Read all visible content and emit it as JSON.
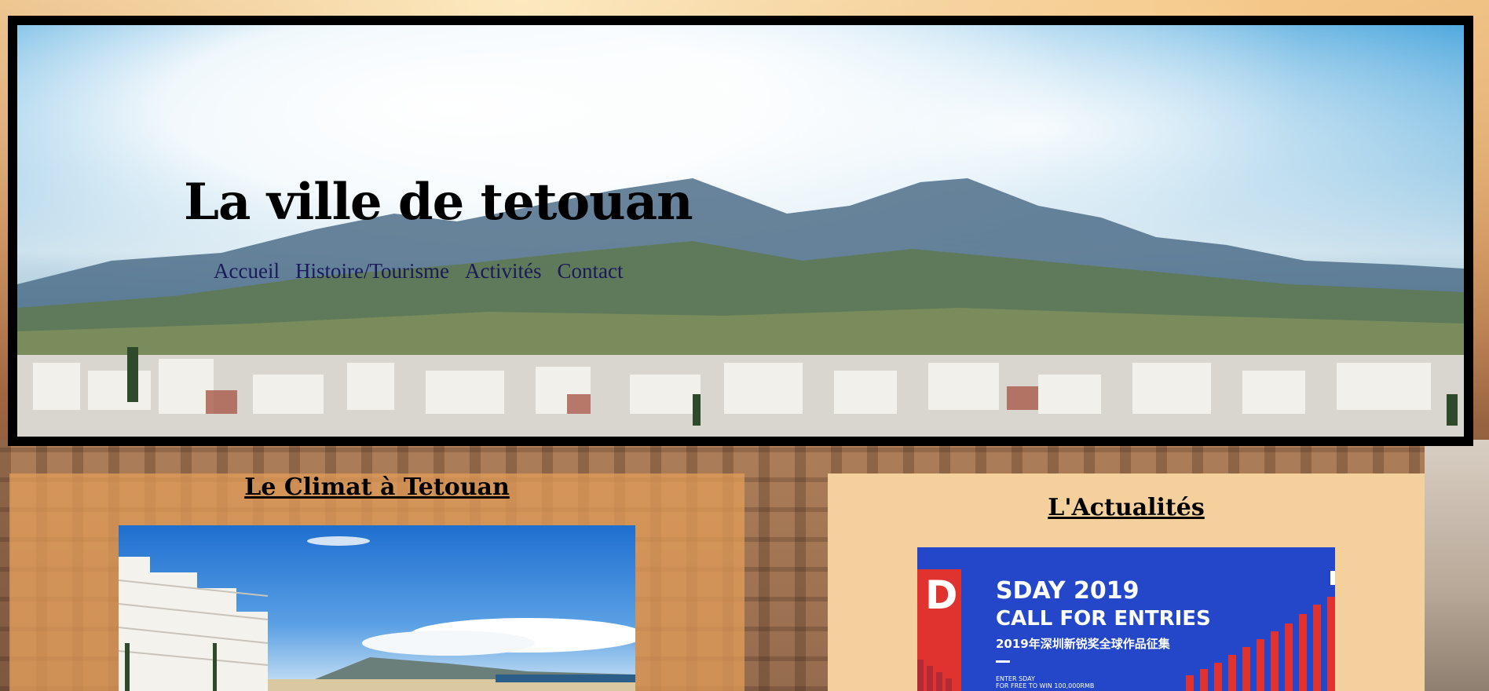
{
  "header": {
    "title": "La ville de tetouan",
    "nav": [
      "Accueil",
      "Histoire/Tourisme",
      "Activités",
      "Contact"
    ]
  },
  "climate": {
    "title": "Le Climat à Tetouan"
  },
  "news": {
    "title": "L'Actualités",
    "banner": {
      "logo_letter": "D",
      "line1": "SDAY 2019",
      "line2": "CALL FOR ENTRIES",
      "line3": "2019年深圳新锐奖全球作品征集",
      "small1": "ENTER SDAY",
      "small2": "FOR FREE TO WIN 100,000RMB"
    }
  },
  "colors": {
    "header_border": "#000000",
    "climate_panel": "#e6a05a",
    "news_panel": "#f4d09c",
    "banner_blue": "#2446c8",
    "banner_red": "#e0332f",
    "nav_link": "#1a1a5a"
  }
}
